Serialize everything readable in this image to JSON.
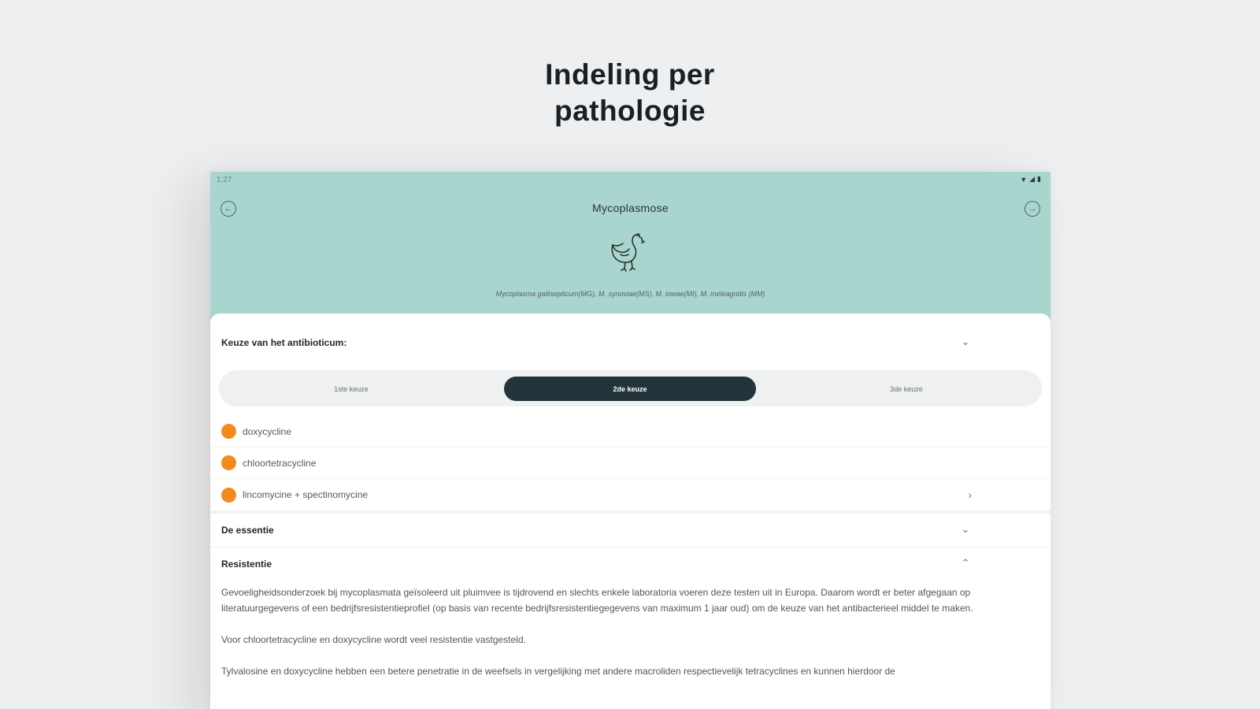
{
  "promo": {
    "title_line1": "Indeling per",
    "title_line2": "pathologie"
  },
  "status_bar": {
    "time": "1:27"
  },
  "header": {
    "title": "Mycoplasmose",
    "pathogens": "Mycoplasma gallisepticum(MG), M. synoviae(MS), M. iowae(MI), M. meleagridis (MM)",
    "accent_color": "#a8d6ce"
  },
  "sections": {
    "antibiotic_choice": "Keuze van het antibioticum:",
    "essence": "De essentie",
    "resistance": "Resistentie"
  },
  "choice_tabs": [
    {
      "label": "1ste keuze",
      "selected": false
    },
    {
      "label": "2de keuze",
      "selected": true
    },
    {
      "label": "3de keuze",
      "selected": false
    }
  ],
  "drugs": [
    {
      "name": "doxycycline",
      "dot_color": "#f28b1d"
    },
    {
      "name": "chloortetracycline",
      "dot_color": "#f28b1d"
    },
    {
      "name": "lincomycine + spectinomycine",
      "dot_color": "#f28b1d"
    }
  ],
  "resistance_text": [
    "Gevoeligheidsonderzoek bij mycoplasmata geïsoleerd uit pluimvee is tijdrovend en slechts enkele laboratoria voeren deze testen uit in Europa. Daarom wordt er beter afgegaan op literatuurgegevens of een bedrijfsresistentieprofiel (op basis van recente bedrijfsresistentiegegevens van maximum 1 jaar oud) om de keuze van het antibacterieel middel te maken.",
    "Voor chloortetracycline en doxycycline wordt veel resistentie vastgesteld.",
    "Tylvalosine en doxycycline hebben een betere penetratie in de weefsels in vergelijking met andere macroliden respectievelijk tetracyclines en kunnen hierdoor de"
  ]
}
